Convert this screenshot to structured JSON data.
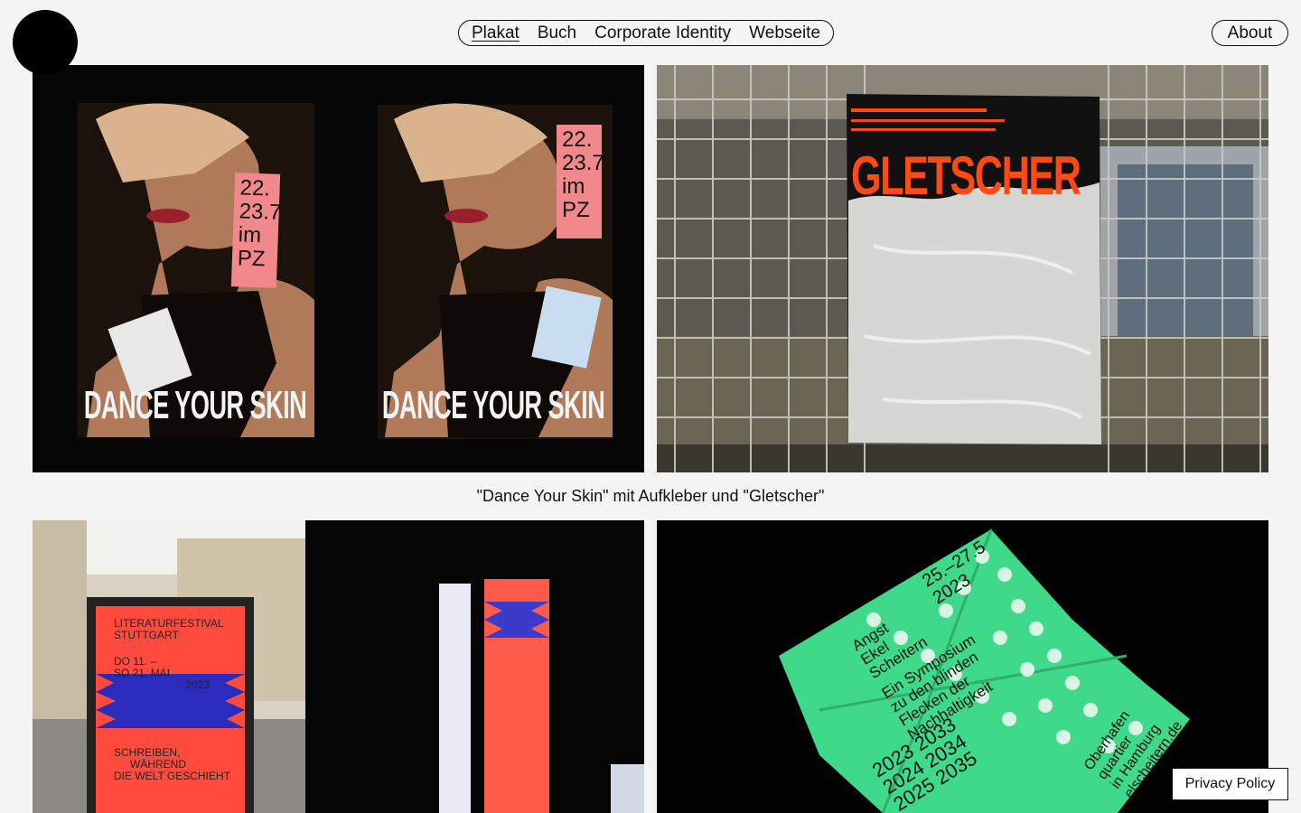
{
  "nav": {
    "items": [
      {
        "label": "Plakat",
        "active": true
      },
      {
        "label": "Buch",
        "active": false
      },
      {
        "label": "Corporate Identity",
        "active": false
      },
      {
        "label": "Webseite",
        "active": false
      }
    ],
    "about_label": "About"
  },
  "gallery": {
    "tiles": [
      {
        "poster_title": "DANCE YOUR SKIN",
        "sticker_lines": [
          "22.",
          "23.7",
          "im",
          "PZ"
        ]
      },
      {
        "poster_title": "GLETSCHER"
      },
      {
        "poster_lines": [
          "LITERATURFESTIVAL",
          "STUTTGART",
          "DO 11. –",
          "SO 21. MAI",
          "2023",
          "SCHREIBEN,",
          "WÄHREND",
          "DIE WELT GESCHIEHT"
        ]
      },
      {
        "poster_lines": [
          "25.–27.5",
          "2023",
          "Angst",
          "Ekel",
          "Scheitern",
          "Ein Symposium",
          "zu den blinden",
          "Flecken der",
          "Nachhaltigkeit",
          "2023 2033",
          "2024 2034",
          "2025 2035",
          "Oberhafen",
          "quartier",
          "in Hamburg",
          "elscheitern.de"
        ]
      }
    ],
    "caption": "\"Dance Your Skin\" mit Aufkleber und \"Gletscher\""
  },
  "footer": {
    "privacy_label": "Privacy Policy"
  },
  "colors": {
    "background": "#f4f4f4",
    "text": "#111111",
    "sticker_pink": "#f0888c",
    "gletscher_orange": "#ff4a14",
    "festival_red": "#ff4b3e",
    "symposium_green": "#3fd98a"
  }
}
